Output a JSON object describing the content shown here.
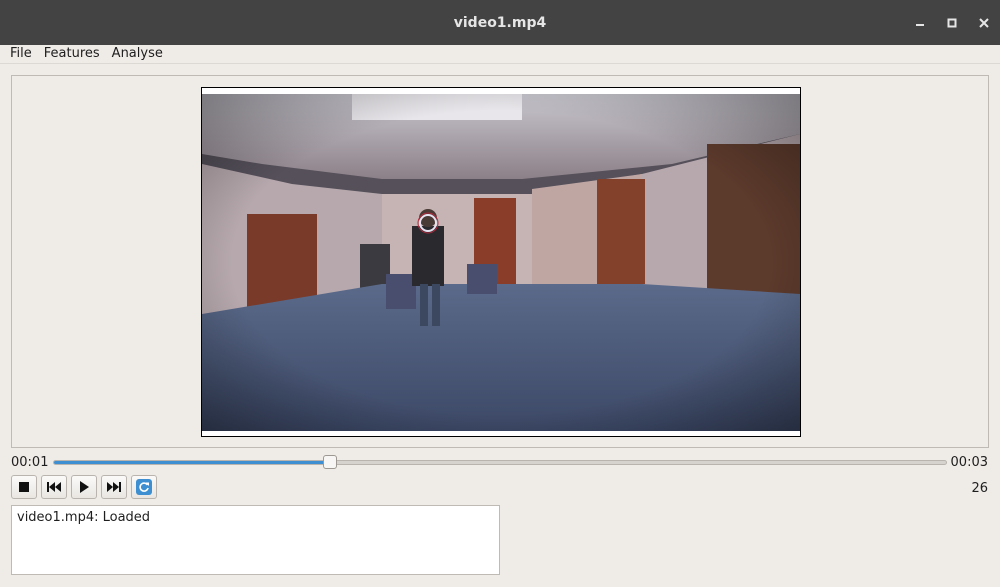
{
  "window": {
    "title": "video1.mp4",
    "minimize_icon": "minimize-icon",
    "maximize_icon": "maximize-icon",
    "close_icon": "close-icon"
  },
  "menu": {
    "items": [
      {
        "label": "File"
      },
      {
        "label": "Features"
      },
      {
        "label": "Analyse"
      }
    ]
  },
  "player": {
    "current_time": "00:01",
    "end_time": "00:03",
    "progress_fraction": 0.31,
    "frame_number": "26",
    "buttons": [
      {
        "name": "stop-button",
        "icon": "stop-icon"
      },
      {
        "name": "previous-button",
        "icon": "skip-back-icon"
      },
      {
        "name": "play-button",
        "icon": "play-icon"
      },
      {
        "name": "next-button",
        "icon": "skip-forward-icon"
      },
      {
        "name": "reload-button",
        "icon": "refresh-icon"
      }
    ],
    "accent_color": "#3d8fd1"
  },
  "log": {
    "text": "video1.mp4: Loaded"
  }
}
